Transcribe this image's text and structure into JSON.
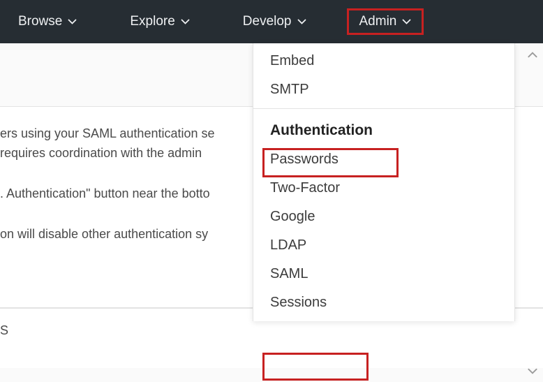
{
  "nav": {
    "browse": "Browse",
    "explore": "Explore",
    "develop": "Develop",
    "admin": "Admin"
  },
  "background": {
    "line1": "ers using your SAML authentication se",
    "line2": " requires coordination with the admin",
    "line3": ". Authentication\" button near the botto",
    "line4": "on will disable other authentication sy",
    "lower": "S"
  },
  "dropdown": {
    "group1": {
      "trunc": "",
      "embed": "Embed",
      "smtp": "SMTP"
    },
    "group2": {
      "header": "Authentication",
      "passwords": "Passwords",
      "twofactor": "Two-Factor",
      "google": "Google",
      "ldap": "LDAP",
      "saml": "SAML",
      "sessions": "Sessions"
    }
  }
}
